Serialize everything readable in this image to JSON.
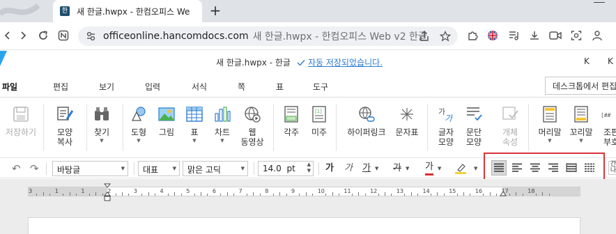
{
  "browser": {
    "tab_title": "새 한글.hwpx - 한컴오피스 We",
    "new_tab_label": "+",
    "url_host": "officeonline.hancomdocs.com",
    "url_rest": "새 한글.hwpx - 한컴오피스 Web v2 한글"
  },
  "app_header": {
    "doc_title": "새 한글.hwpx - 한글",
    "save_status": "자동 저장되었습니다.",
    "right_letter_1": "K",
    "right_letter_2": "K"
  },
  "menu": {
    "items": [
      "파일",
      "편집",
      "보기",
      "입력",
      "서식",
      "쪽",
      "표",
      "도구"
    ],
    "desktop_button": "데스크톱에서 편집"
  },
  "ribbon": {
    "buttons": [
      {
        "name": "save",
        "line1": "저장하기",
        "line2": "",
        "disabled": true,
        "icon": "save-icon"
      },
      {
        "name": "format-copy",
        "line1": "모양",
        "line2": "복사",
        "disabled": false,
        "icon": "format-painter-icon"
      },
      {
        "name": "find",
        "line1": "찾기",
        "line2": "",
        "disabled": false,
        "icon": "binoculars-icon"
      },
      {
        "name": "shape",
        "line1": "도형",
        "line2": "",
        "disabled": false,
        "icon": "shapes-icon"
      },
      {
        "name": "picture",
        "line1": "그림",
        "line2": "",
        "disabled": false,
        "icon": "picture-icon"
      },
      {
        "name": "table",
        "line1": "표",
        "line2": "",
        "disabled": false,
        "icon": "table-icon"
      },
      {
        "name": "chart",
        "line1": "차트",
        "line2": "",
        "disabled": false,
        "icon": "bar-chart-icon"
      },
      {
        "name": "web-video",
        "line1": "웹",
        "line2": "동영상",
        "disabled": false,
        "icon": "web-video-icon"
      },
      {
        "name": "footnote",
        "line1": "각주",
        "line2": "",
        "disabled": false,
        "icon": "footnote-icon"
      },
      {
        "name": "endnote",
        "line1": "미주",
        "line2": "",
        "disabled": false,
        "icon": "endnote-icon"
      },
      {
        "name": "hyperlink",
        "line1": "하이퍼링크",
        "line2": "",
        "disabled": false,
        "icon": "hyperlink-icon"
      },
      {
        "name": "symbol",
        "line1": "문자표",
        "line2": "",
        "disabled": false,
        "icon": "symbol-icon"
      },
      {
        "name": "char-shape",
        "line1": "글자",
        "line2": "모양",
        "disabled": false,
        "icon": "char-shape-icon"
      },
      {
        "name": "para-shape",
        "line1": "문단",
        "line2": "모양",
        "disabled": false,
        "icon": "para-shape-icon"
      },
      {
        "name": "object-props",
        "line1": "개체",
        "line2": "속성",
        "disabled": true,
        "icon": "object-props-icon"
      },
      {
        "name": "header",
        "line1": "머리말",
        "line2": "",
        "disabled": false,
        "icon": "header-icon"
      },
      {
        "name": "footer",
        "line1": "꼬리말",
        "line2": "",
        "disabled": false,
        "icon": "footer-icon"
      },
      {
        "name": "page-num",
        "line1": "조판",
        "line2": "부호",
        "disabled": false,
        "icon": "page-code-icon"
      }
    ]
  },
  "format_toolbar": {
    "style": "바탕글",
    "font_lang": "대표",
    "font_name": "맑은 고딕",
    "font_size": "14.0",
    "font_unit": "pt",
    "bold": "가",
    "italic": "가",
    "underline": "가",
    "strike": "가",
    "font_color": "가",
    "right_stub_top": "간",
    "right_stub_bottom": "나"
  },
  "ruler": {
    "labels": [
      "3",
      "1",
      "1",
      "2",
      "3",
      "4",
      "5",
      "6",
      "7",
      "8",
      "9",
      "10",
      "11",
      "12",
      "13",
      "14",
      "15",
      "16",
      "17",
      "18"
    ]
  },
  "colors": {
    "accent": "#2b7bd1",
    "highlight_box": "#d9343a",
    "font_color_bar": "#d32f2f",
    "highlighter_bar": "#f3d234"
  }
}
